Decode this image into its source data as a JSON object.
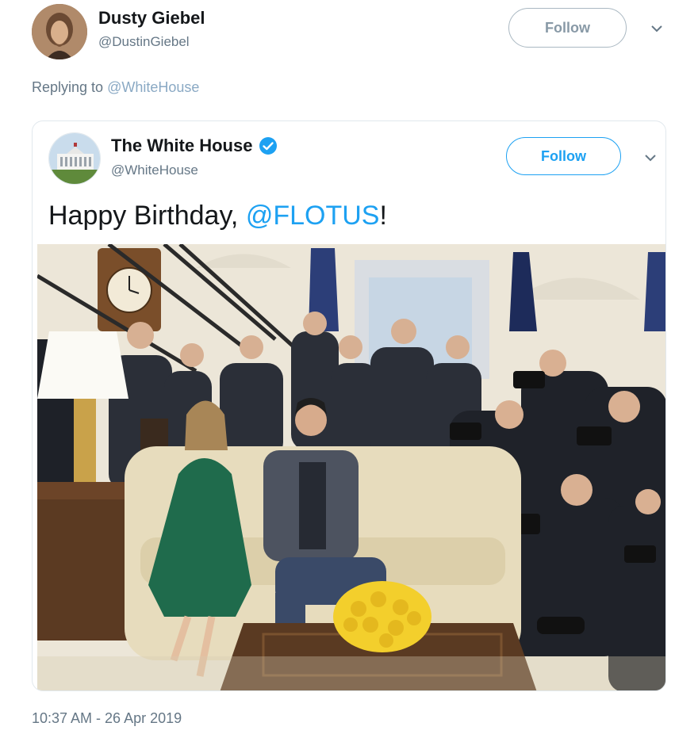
{
  "tweet": {
    "author_name": "Dusty Giebel",
    "author_handle": "@DustinGiebel",
    "follow_label": "Follow",
    "reply_prefix": "Replying to",
    "reply_to": "@WhiteHouse",
    "timestamp": "10:37 AM - 26 Apr 2019"
  },
  "quoted": {
    "author_name": "The White House",
    "author_handle": "@WhiteHouse",
    "follow_label": "Follow",
    "text_prefix": "Happy Birthday, ",
    "mention": "@FLOTUS",
    "text_suffix": "!"
  },
  "colors": {
    "twitter_blue": "#1da1f2",
    "muted": "#657786"
  },
  "icons": {
    "verified": "verified-badge-icon",
    "chevron": "chevron-down-icon"
  }
}
